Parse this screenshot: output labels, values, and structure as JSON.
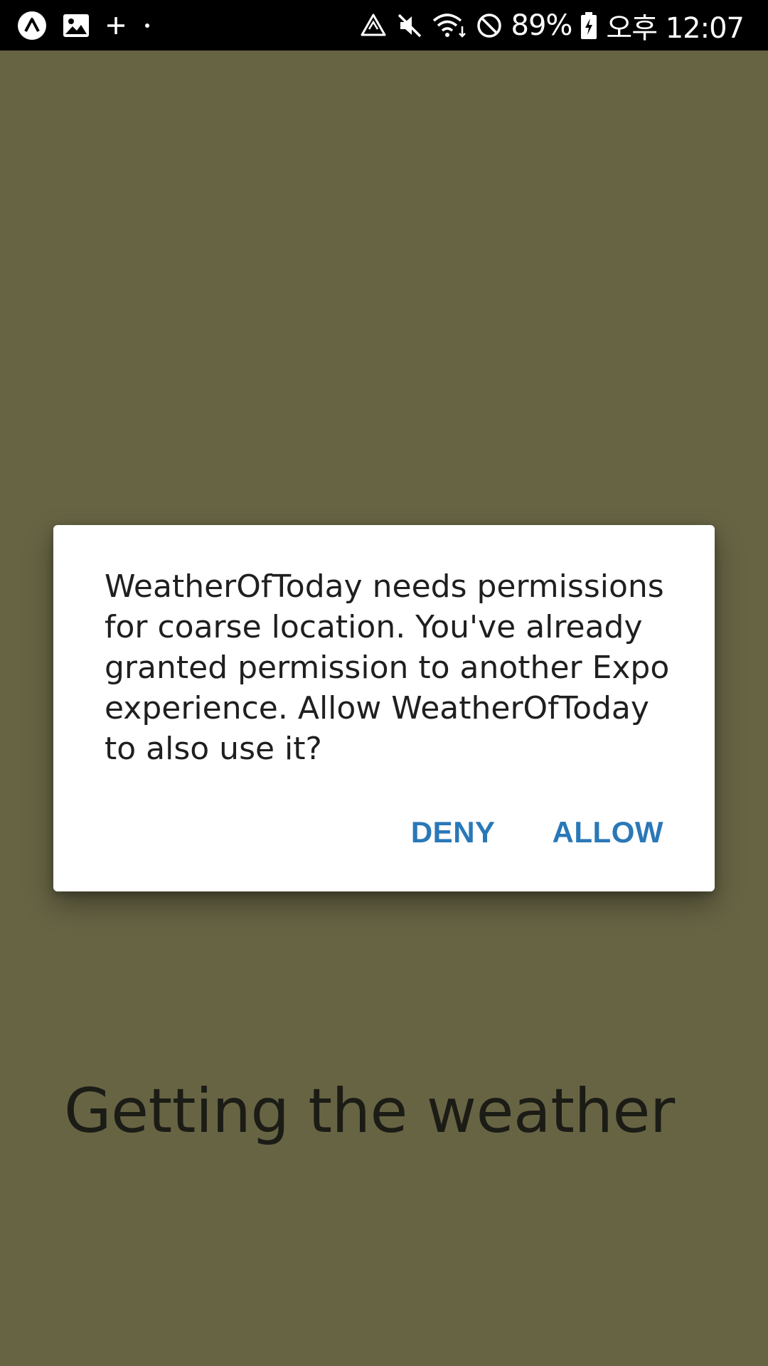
{
  "status_bar": {
    "left_icons": [
      "expo-icon",
      "image-icon",
      "plus-icon",
      "dot-icon"
    ],
    "right_icons": [
      "recycle-icon",
      "mute-icon",
      "wifi-icon",
      "block-icon",
      "battery-icon"
    ],
    "battery": "89%",
    "time": "오후 12:07"
  },
  "app": {
    "background_color": "#676444",
    "loading_text": "Getting the weather"
  },
  "dialog": {
    "message": "WeatherOfToday needs permissions for coarse location. You've already granted permission to another Expo experience. Allow WeatherOfToday to also use it?",
    "deny_label": "DENY",
    "allow_label": "ALLOW",
    "accent_color": "#2a78b8"
  }
}
